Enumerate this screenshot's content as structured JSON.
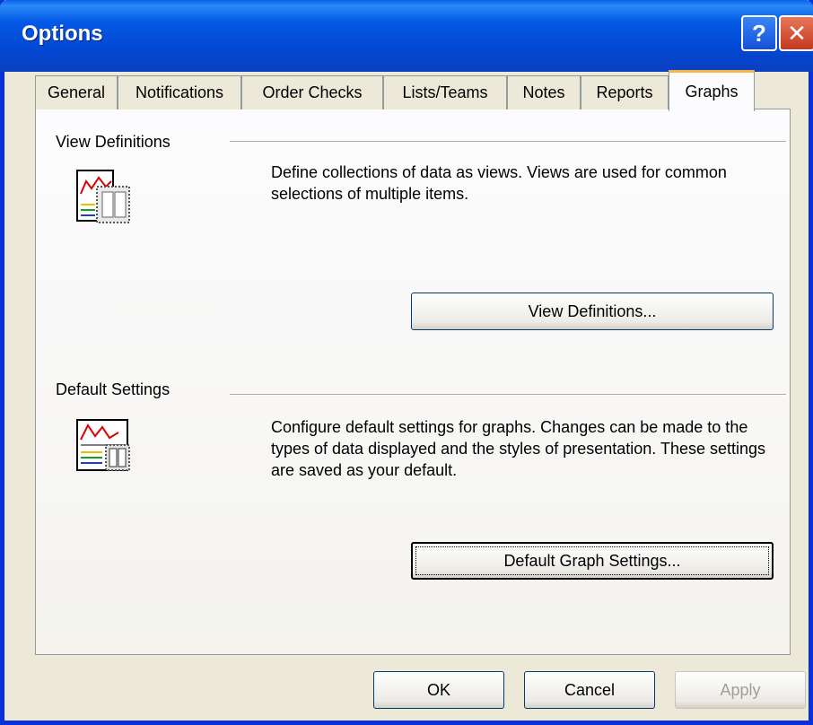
{
  "window": {
    "title": "Options"
  },
  "titlebar": {
    "help_glyph": "?",
    "close_glyph": "✕"
  },
  "tabs": [
    {
      "label": "General"
    },
    {
      "label": "Notifications"
    },
    {
      "label": "Order Checks"
    },
    {
      "label": "Lists/Teams"
    },
    {
      "label": "Notes"
    },
    {
      "label": "Reports"
    },
    {
      "label": "Graphs",
      "active": true
    }
  ],
  "sections": {
    "view_definitions": {
      "label": "View Definitions",
      "description": "Define collections of data as views. Views are used for common selections of multiple items.",
      "button": "View Definitions...",
      "icon": "graph-view-icon"
    },
    "default_settings": {
      "label": "Default Settings",
      "description": "Configure default settings for graphs. Changes can be made to the types of data displayed and the styles of presentation. These settings are saved as your default.",
      "button": "Default Graph Settings...",
      "icon": "graph-settings-icon"
    }
  },
  "footer": {
    "ok": "OK",
    "cancel": "Cancel",
    "apply": "Apply"
  },
  "colors": {
    "titlebar": "#0458e6",
    "frame": "#0831d9",
    "face": "#ece9d8",
    "tab_highlight": "#f9b44a"
  }
}
